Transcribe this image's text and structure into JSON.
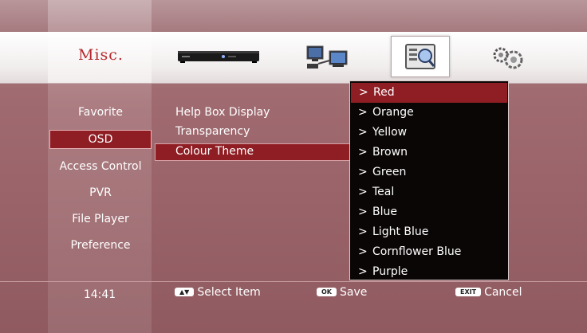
{
  "header": {
    "title": "Misc.",
    "icons": [
      "set-top-box-icon",
      "network-pc-icon",
      "misc-info-icon",
      "settings-gears-icon"
    ],
    "selected_icon": "misc-info-icon"
  },
  "sidebar": {
    "items": [
      {
        "label": "Favorite",
        "selected": false
      },
      {
        "label": "OSD",
        "selected": true
      },
      {
        "label": "Access Control",
        "selected": false
      },
      {
        "label": "PVR",
        "selected": false
      },
      {
        "label": "File Player",
        "selected": false
      },
      {
        "label": "Preference",
        "selected": false
      }
    ]
  },
  "options": [
    {
      "label": "Help Box Display",
      "selected": false
    },
    {
      "label": "Transparency",
      "selected": false
    },
    {
      "label": "Colour Theme",
      "selected": true
    }
  ],
  "dropdown": {
    "arrow": ">",
    "items": [
      {
        "label": "Red",
        "selected": true
      },
      {
        "label": "Orange",
        "selected": false
      },
      {
        "label": "Yellow",
        "selected": false
      },
      {
        "label": "Brown",
        "selected": false
      },
      {
        "label": "Green",
        "selected": false
      },
      {
        "label": "Teal",
        "selected": false
      },
      {
        "label": "Blue",
        "selected": false
      },
      {
        "label": "Light Blue",
        "selected": false
      },
      {
        "label": "Cornflower Blue",
        "selected": false
      },
      {
        "label": "Purple",
        "selected": false
      }
    ]
  },
  "footer": {
    "time": "14:41",
    "hints": [
      {
        "key": "▲▼",
        "label": "Select Item"
      },
      {
        "key": "OK",
        "label": "Save"
      },
      {
        "key": "EXIT",
        "label": "Cancel"
      }
    ]
  },
  "colors": {
    "accent": "#8f1e24",
    "title": "#b5282c",
    "background": "#9f6a70",
    "dropdown_bg": "#0b0606"
  }
}
